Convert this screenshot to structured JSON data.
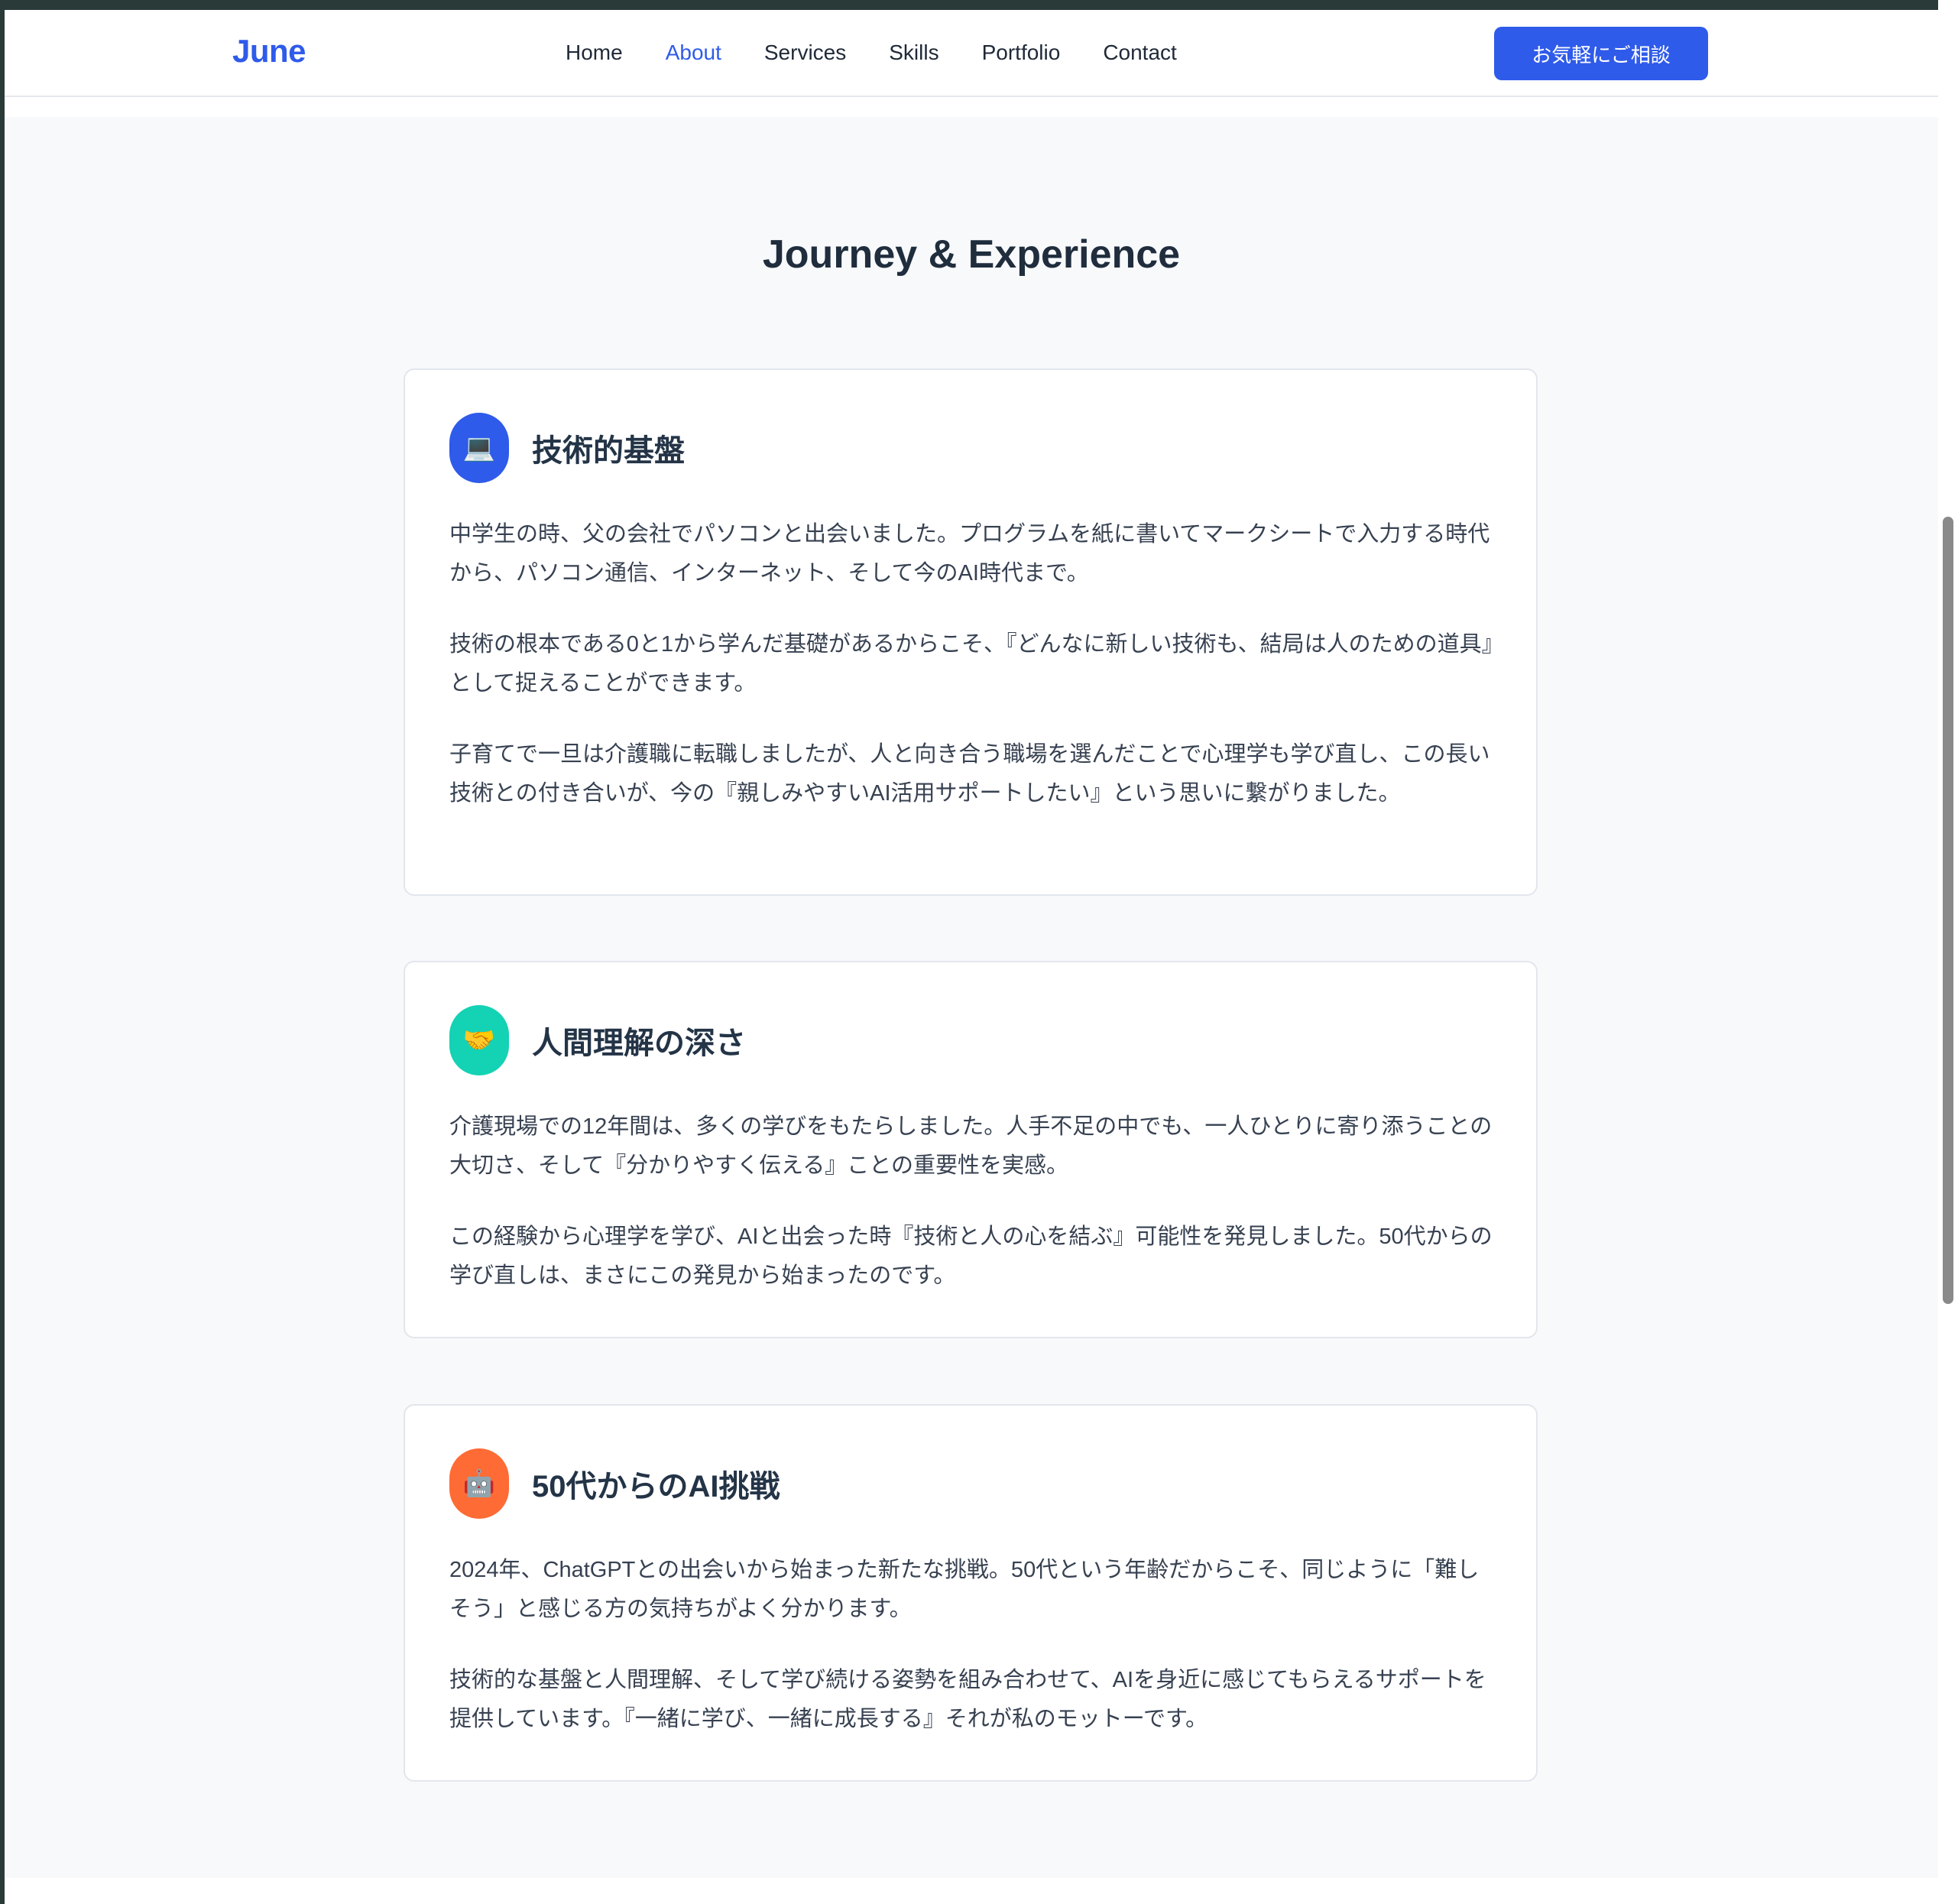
{
  "nav": {
    "logo": "June",
    "links": [
      "Home",
      "About",
      "Services",
      "Skills",
      "Portfolio",
      "Contact"
    ],
    "active": "About",
    "cta_label": "お気軽にご相談"
  },
  "section": {
    "title": "Journey & Experience"
  },
  "cards": [
    {
      "icon": "laptop-icon",
      "icon_glyph": "💻",
      "icon_color": "#2f5bea",
      "title": "技術的基盤",
      "paragraphs": [
        "中学生の時、父の会社でパソコンと出会いました。プログラムを紙に書いてマークシートで入力する時代から、パソコン通信、インターネット、そして今のAI時代まで。",
        "技術の根本である0と1から学んだ基礎があるからこそ、『どんなに新しい技術も、結局は人のための道具』として捉えることができます。",
        "子育てで一旦は介護職に転職しましたが、人と向き合う職場を選んだことで心理学も学び直し、この長い技術との付き合いが、今の『親しみやすいAI活用サポートしたい』という思いに繋がりました。"
      ]
    },
    {
      "icon": "handshake-icon",
      "icon_glyph": "🤝",
      "icon_color": "#14d2b4",
      "title": "人間理解の深さ",
      "paragraphs": [
        "介護現場での12年間は、多くの学びをもたらしました。人手不足の中でも、一人ひとりに寄り添うことの大切さ、そして『分かりやすく伝える』ことの重要性を実感。",
        "この経験から心理学を学び、AIと出会った時『技術と人の心を結ぶ』可能性を発見しました。50代からの学び直しは、まさにこの発見から始まったのです。"
      ]
    },
    {
      "icon": "robot-icon",
      "icon_glyph": "🤖",
      "icon_color": "#ff6b35",
      "title": "50代からのAI挑戦",
      "paragraphs": [
        "2024年、ChatGPTとの出会いから始まった新たな挑戦。50代という年齢だからこそ、同じように「難しそう」と感じる方の気持ちがよく分かります。",
        "技術的な基盤と人間理解、そして学び続ける姿勢を組み合わせて、AIを身近に感じてもらえるサポートを提供しています。『一緒に学び、一緒に成長する』それが私のモットーです。"
      ]
    }
  ]
}
